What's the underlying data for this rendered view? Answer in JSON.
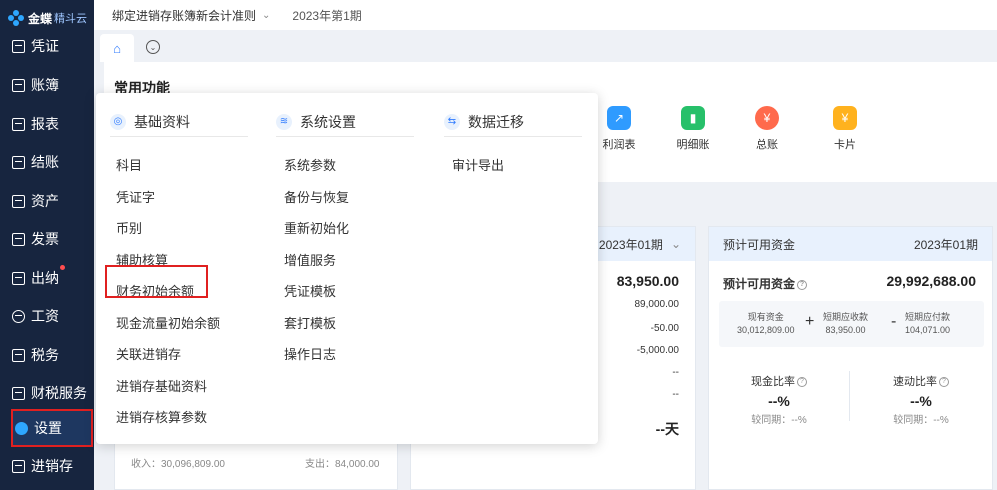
{
  "brand": {
    "name": "金蝶",
    "sub": "精斗云"
  },
  "sidebar": {
    "items": [
      {
        "label": "凭证",
        "icon": "voucher-icon"
      },
      {
        "label": "账簿",
        "icon": "ledger-icon"
      },
      {
        "label": "报表",
        "icon": "report-icon"
      },
      {
        "label": "结账",
        "icon": "closing-icon"
      },
      {
        "label": "资产",
        "icon": "asset-icon"
      },
      {
        "label": "发票",
        "icon": "invoice-icon"
      },
      {
        "label": "出纳",
        "icon": "cashier-icon"
      },
      {
        "label": "工资",
        "icon": "salary-icon"
      },
      {
        "label": "税务",
        "icon": "tax-icon"
      },
      {
        "label": "财税服务",
        "icon": "finance-service-icon"
      },
      {
        "label": "设置",
        "icon": "settings-icon"
      },
      {
        "label": "进销存",
        "icon": "inventory-icon"
      }
    ]
  },
  "topbar": {
    "title": "绑定进销存账簿新会计准则",
    "period": "2023年第1期"
  },
  "tabs": {
    "home_icon": "⌂"
  },
  "common": {
    "title": "常用功能",
    "functions": [
      {
        "label": "利润表",
        "color": "#2f9bff",
        "glyph": "↗"
      },
      {
        "label": "明细账",
        "color": "#27c06a",
        "glyph": "▮"
      },
      {
        "label": "总账",
        "color": "#ff6a4c",
        "glyph": "¥"
      },
      {
        "label": "卡片",
        "color": "#ffb21e",
        "glyph": "¥"
      }
    ]
  },
  "cards": {
    "left": {
      "income_label": "收入：",
      "income": "30,096,809.00",
      "expense_label": "支出：",
      "expense": "84,000.00"
    },
    "mid": {
      "period": "2023年01期",
      "total": "83,950.00",
      "rows": [
        "89,000.00",
        "-50.00",
        "-5,000.00",
        "--",
        "--"
      ],
      "days": "--天"
    },
    "right": {
      "title": "预计可用资金",
      "period": "2023年01期",
      "label": "预计可用资金",
      "total": "29,992,688.00",
      "cash_label": "现有资金",
      "cash": "30,012,809.00",
      "ar_label": "短期应收款",
      "ar": "83,950.00",
      "ap_label": "短期应付款",
      "ap": "104,071.00",
      "ratio1_label": "现金比率",
      "ratio1": "--%",
      "ratio1_yoy": "较同期：--%",
      "ratio2_label": "速动比率",
      "ratio2": "--%",
      "ratio2_yoy": "较同期：--%"
    }
  },
  "dropdown": {
    "columns": [
      {
        "title": "基础资料",
        "icon": "basic-data-icon",
        "items": [
          "科目",
          "凭证字",
          "币别",
          "辅助核算",
          "财务初始余额",
          "现金流量初始余额",
          "关联进销存",
          "进销存基础资料",
          "进销存核算参数"
        ]
      },
      {
        "title": "系统设置",
        "icon": "system-settings-icon",
        "items": [
          "系统参数",
          "备份与恢复",
          "重新初始化",
          "增值服务",
          "凭证模板",
          "套打模板",
          "操作日志"
        ]
      },
      {
        "title": "数据迁移",
        "icon": "data-migration-icon",
        "items": [
          "审计导出"
        ]
      }
    ]
  }
}
